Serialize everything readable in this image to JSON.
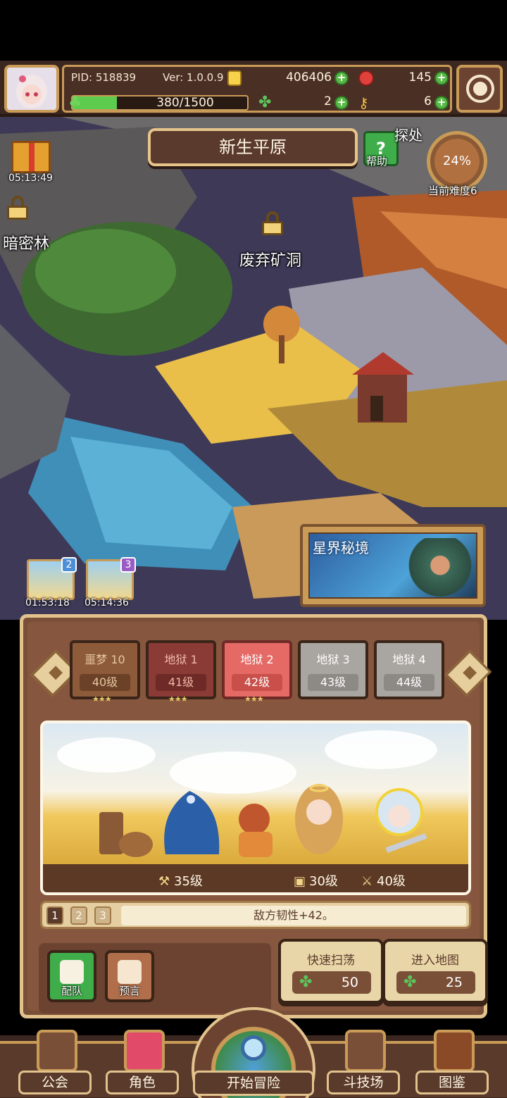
{
  "header": {
    "pid": "PID: 518839",
    "version": "Ver: 1.0.0.9",
    "gold": "406406",
    "rubies": "145",
    "xp_text": "380/1500",
    "xp_progress": 0.2533,
    "clovers": "2",
    "keys": "6"
  },
  "map": {
    "region_title": "新生平原",
    "help_label": "帮助",
    "explore_label": "探处",
    "difficulty_percent": "24%",
    "difficulty_label": "当前难度6",
    "gift_timer": "05:13:49",
    "locked_area_left": "暗密林",
    "locked_area_center": "废弃矿洞",
    "event_banner": "星界秘境",
    "card_slots": [
      {
        "badge": "2",
        "timer": "01:53:18"
      },
      {
        "badge": "3",
        "timer": "05:14:36"
      }
    ]
  },
  "stages": [
    {
      "name": "噩梦 10",
      "level": "40级",
      "stars": "★★★"
    },
    {
      "name": "地狱 1",
      "level": "41级",
      "stars": "★★★"
    },
    {
      "name": "地狱 2",
      "level": "42级",
      "stars": "★★★"
    },
    {
      "name": "地狱 3",
      "level": "43级",
      "stars": ""
    },
    {
      "name": "地狱 4",
      "level": "44级",
      "stars": ""
    }
  ],
  "battle": {
    "stat_pickaxe": "35级",
    "stat_chest": "30级",
    "stat_sword": "40级",
    "pages": [
      "1",
      "2",
      "3"
    ],
    "buff_text": "敌方韧性+42。"
  },
  "actions": {
    "team_label": "配队",
    "preview_label": "预言",
    "sweep_label": "快速扫荡",
    "sweep_cost": "50",
    "enter_label": "进入地图",
    "enter_cost": "25"
  },
  "nav": {
    "guild": "公会",
    "character": "角色",
    "start": "开始冒险",
    "arena": "斗技场",
    "codex": "图鉴"
  },
  "colors": {
    "frame": "#c99b57",
    "panel": "#7a4f38",
    "accent_green": "#5cc45c",
    "hell_active": "#e56a66"
  }
}
